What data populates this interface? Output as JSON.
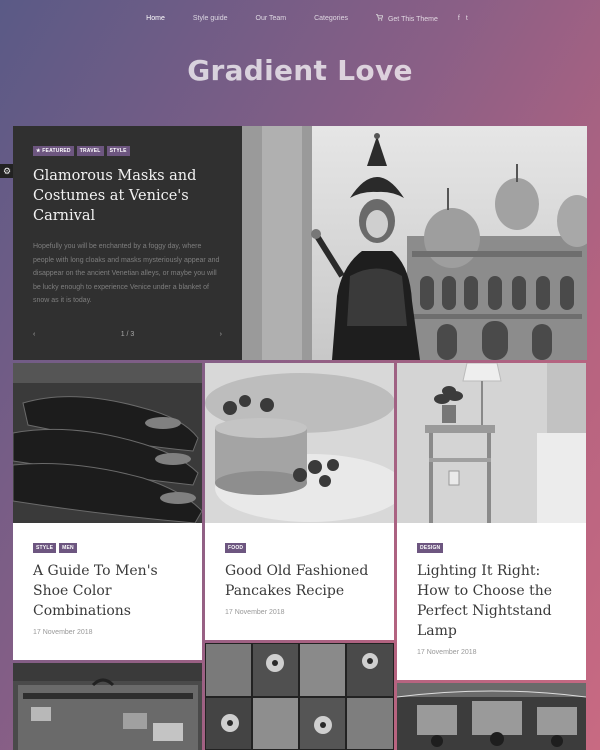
{
  "nav": {
    "items": [
      "Home",
      "Style guide",
      "Our Team",
      "Categories"
    ],
    "cta": "Get This Theme",
    "social": [
      "f",
      "t"
    ]
  },
  "site": {
    "title": "Gradient Love"
  },
  "featured": {
    "tags": [
      "Featured",
      "Travel",
      "Style"
    ],
    "title": "Glamorous Masks and Costumes at Venice's Carnival",
    "excerpt": "Hopefully you will be enchanted by a foggy day, where people with long cloaks and masks mysteriously appear and disappear on the ancient Venetian alleys, or maybe you will be lucky enough to experience Venice under a blanket of snow as it is today.",
    "prev": "‹",
    "next": "›",
    "pager": "1 / 3"
  },
  "cards": [
    {
      "tags": [
        "Style",
        "Men"
      ],
      "title": "A Guide To Men's Shoe Color Combinations",
      "date": "17 November 2018"
    },
    {
      "tags": [
        "Food"
      ],
      "title": "Good Old Fashioned Pancakes Recipe",
      "date": "17 November 2018"
    },
    {
      "tags": [
        "Design"
      ],
      "title": "Lighting It Right: How to Choose the Perfect Nightstand Lamp",
      "date": "17 November 2018"
    }
  ],
  "icons": {
    "settings": "gear-icon",
    "cart": "cart-icon",
    "facebook": "facebook-icon",
    "twitter": "twitter-icon"
  }
}
